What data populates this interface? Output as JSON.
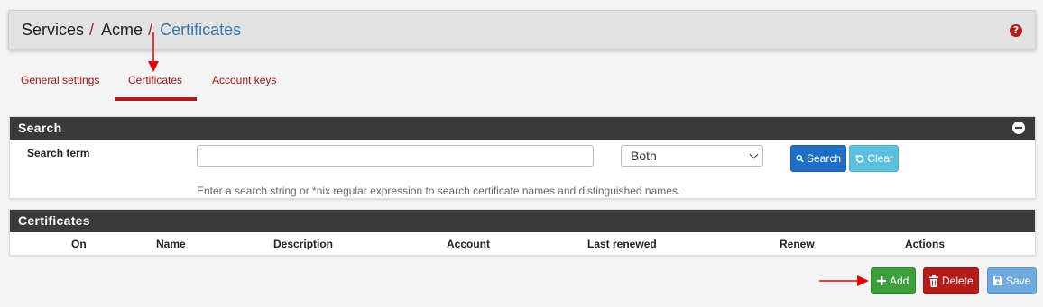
{
  "breadcrumb": {
    "items": [
      "Services",
      "Acme",
      "Certificates"
    ],
    "separator": "/"
  },
  "help_icon": "question-circle-icon",
  "tabs": [
    {
      "label": "General settings",
      "active": false
    },
    {
      "label": "Certificates",
      "active": true
    },
    {
      "label": "Account keys",
      "active": false
    }
  ],
  "search_panel": {
    "title": "Search",
    "term_label": "Search term",
    "term_value": "",
    "scope_selected": "Both",
    "search_button": "Search",
    "clear_button": "Clear",
    "help_text": "Enter a search string or *nix regular expression to search certificate names and distinguished names."
  },
  "certificates_panel": {
    "title": "Certificates",
    "columns": [
      "On",
      "Name",
      "Description",
      "Account",
      "Last renewed",
      "Renew",
      "Actions"
    ],
    "rows": []
  },
  "actions": {
    "add": "Add",
    "delete": "Delete",
    "save": "Save"
  },
  "colors": {
    "accent_red": "#a81c1c",
    "link_blue": "#3a78b5",
    "panel_header": "#3a3a3a",
    "add_green": "#3c9f3c",
    "delete_red": "#b51c1c",
    "search_blue": "#1e6fc5",
    "clear_cyan": "#5bc0de"
  }
}
